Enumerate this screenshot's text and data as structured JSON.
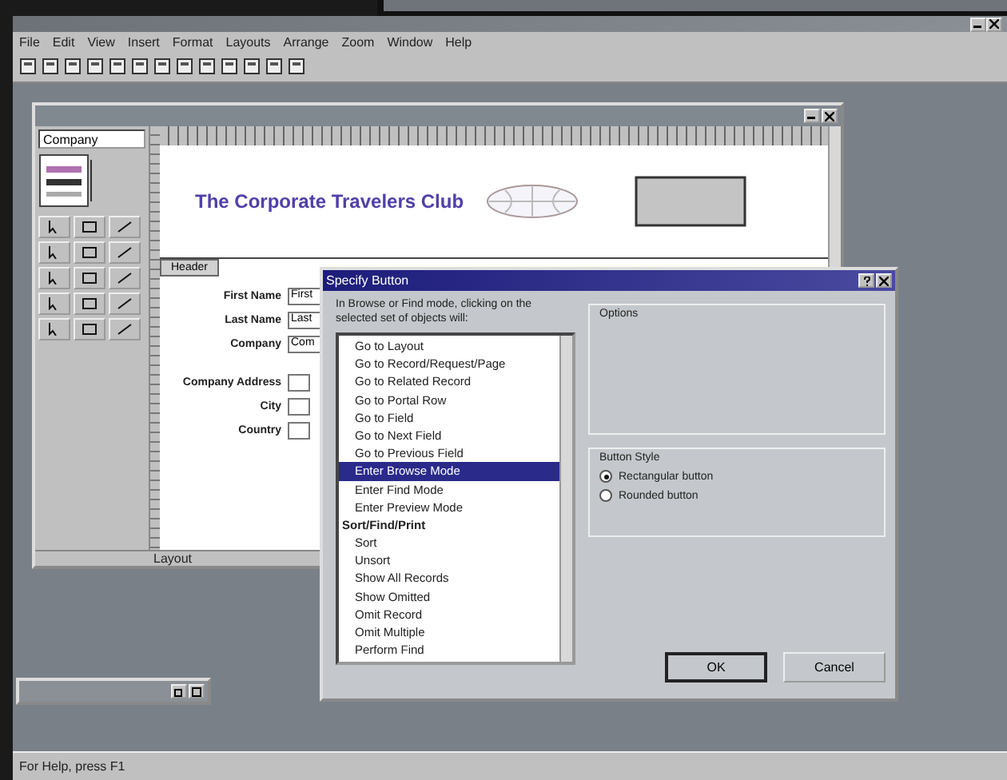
{
  "app": {
    "menu": [
      "File",
      "Edit",
      "View",
      "Insert",
      "Format",
      "Layouts",
      "Arrange",
      "Zoom",
      "Window",
      "Help"
    ]
  },
  "layout_window": {
    "layout_menu": "Company",
    "heading": "The Corporate Travelers Club",
    "part_label": "Header",
    "mode": "Layout",
    "fields": [
      {
        "label": "First Name",
        "value": "First"
      },
      {
        "label": "Last Name",
        "value": "Last"
      },
      {
        "label": "Company",
        "value": "Com"
      }
    ],
    "address_fields": [
      {
        "label": "Company Address"
      },
      {
        "label": "City"
      },
      {
        "label": "Country"
      }
    ]
  },
  "dialog": {
    "title": "Specify Button",
    "instructions": "In Browse or Find mode, clicking on the selected set of objects will:",
    "actions": [
      {
        "label": "Go to Layout",
        "kind": "item",
        "selected": false
      },
      {
        "label": "Go to Record/Request/Page",
        "kind": "item",
        "selected": false
      },
      {
        "label": "Go to Related Record",
        "kind": "item",
        "selected": false
      },
      {
        "label": "Go to Portal Row",
        "kind": "item",
        "selected": false
      },
      {
        "label": "Go to Field",
        "kind": "item",
        "selected": false
      },
      {
        "label": "Go to Next Field",
        "kind": "item",
        "selected": false
      },
      {
        "label": "Go to Previous Field",
        "kind": "item",
        "selected": false
      },
      {
        "label": "Enter Browse Mode",
        "kind": "item",
        "selected": true
      },
      {
        "label": "Enter Find Mode",
        "kind": "item",
        "selected": false
      },
      {
        "label": "Enter Preview Mode",
        "kind": "item",
        "selected": false
      },
      {
        "label": "Sort/Find/Print",
        "kind": "heading",
        "selected": false
      },
      {
        "label": "Sort",
        "kind": "item",
        "selected": false
      },
      {
        "label": "Unsort",
        "kind": "item",
        "selected": false
      },
      {
        "label": "Show All Records",
        "kind": "item",
        "selected": false
      },
      {
        "label": "Show Omitted",
        "kind": "item",
        "selected": false
      },
      {
        "label": "Omit Record",
        "kind": "item",
        "selected": false
      },
      {
        "label": "Omit Multiple",
        "kind": "item",
        "selected": false
      },
      {
        "label": "Perform Find",
        "kind": "item",
        "selected": false
      }
    ],
    "options_label": "Options",
    "style_label": "Button Style",
    "styles": [
      {
        "label": "Rectangular button",
        "selected": true
      },
      {
        "label": "Rounded button",
        "selected": false
      }
    ],
    "buttons": [
      "OK",
      "Cancel"
    ]
  },
  "status_bar": "For Help, press F1"
}
